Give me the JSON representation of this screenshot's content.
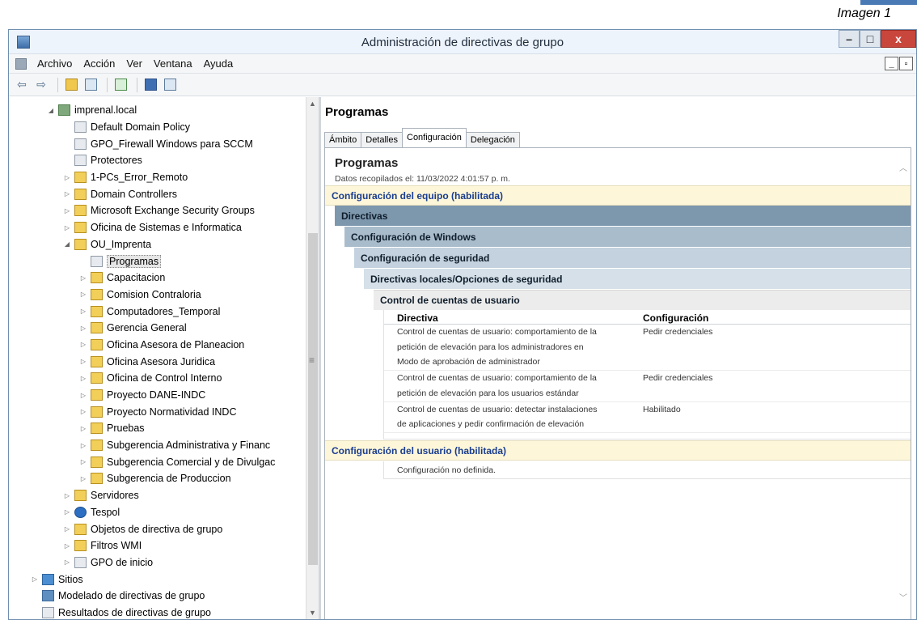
{
  "caption": "Imagen 1",
  "window": {
    "title": "Administración de directivas de grupo"
  },
  "menu": [
    "Archivo",
    "Acción",
    "Ver",
    "Ventana",
    "Ayuda"
  ],
  "tree": [
    {
      "label": "imprenal.local",
      "depth": 3,
      "expander": "open",
      "icon": "domain"
    },
    {
      "label": "Default Domain Policy",
      "depth": 4,
      "expander": "none",
      "icon": "gpo"
    },
    {
      "label": "GPO_Firewall Windows para SCCM",
      "depth": 4,
      "expander": "none",
      "icon": "gpo"
    },
    {
      "label": "Protectores",
      "depth": 4,
      "expander": "none",
      "icon": "gpo"
    },
    {
      "label": "1-PCs_Error_Remoto",
      "depth": 4,
      "expander": "closed",
      "icon": "ou"
    },
    {
      "label": "Domain Controllers",
      "depth": 4,
      "expander": "closed",
      "icon": "ou"
    },
    {
      "label": "Microsoft Exchange Security Groups",
      "depth": 4,
      "expander": "closed",
      "icon": "ou"
    },
    {
      "label": "Oficina de Sistemas e Informatica",
      "depth": 4,
      "expander": "closed",
      "icon": "ou"
    },
    {
      "label": "OU_Imprenta",
      "depth": 4,
      "expander": "open",
      "icon": "ou"
    },
    {
      "label": "Programas",
      "depth": 5,
      "expander": "none",
      "icon": "gpo",
      "selected": true
    },
    {
      "label": "Capacitacion",
      "depth": 5,
      "expander": "closed",
      "icon": "ou"
    },
    {
      "label": "Comision Contraloria",
      "depth": 5,
      "expander": "closed",
      "icon": "ou"
    },
    {
      "label": "Computadores_Temporal",
      "depth": 5,
      "expander": "closed",
      "icon": "ou"
    },
    {
      "label": "Gerencia General",
      "depth": 5,
      "expander": "closed",
      "icon": "ou"
    },
    {
      "label": "Oficina Asesora de Planeacion",
      "depth": 5,
      "expander": "closed",
      "icon": "ou"
    },
    {
      "label": "Oficina Asesora Juridica",
      "depth": 5,
      "expander": "closed",
      "icon": "ou"
    },
    {
      "label": "Oficina de Control Interno",
      "depth": 5,
      "expander": "closed",
      "icon": "ou"
    },
    {
      "label": "Proyecto DANE-INDC",
      "depth": 5,
      "expander": "closed",
      "icon": "ou"
    },
    {
      "label": "Proyecto Normatividad INDC",
      "depth": 5,
      "expander": "closed",
      "icon": "ou"
    },
    {
      "label": "Pruebas",
      "depth": 5,
      "expander": "closed",
      "icon": "ou"
    },
    {
      "label": "Subgerencia Administrativa y Financ",
      "depth": 5,
      "expander": "closed",
      "icon": "ou"
    },
    {
      "label": "Subgerencia Comercial y de Divulgac",
      "depth": 5,
      "expander": "closed",
      "icon": "ou"
    },
    {
      "label": "Subgerencia de Produccion",
      "depth": 5,
      "expander": "closed",
      "icon": "ou"
    },
    {
      "label": "Servidores",
      "depth": 4,
      "expander": "closed",
      "icon": "ou"
    },
    {
      "label": "Tespol",
      "depth": 4,
      "expander": "closed",
      "icon": "info"
    },
    {
      "label": "Objetos de directiva de grupo",
      "depth": 4,
      "expander": "closed",
      "icon": "ou"
    },
    {
      "label": "Filtros WMI",
      "depth": 4,
      "expander": "closed",
      "icon": "ou"
    },
    {
      "label": "GPO de inicio",
      "depth": 4,
      "expander": "closed",
      "icon": "gpo"
    },
    {
      "label": "Sitios",
      "depth": 2,
      "expander": "closed",
      "icon": "site"
    },
    {
      "label": "Modelado de directivas de grupo",
      "depth": 2,
      "expander": "none",
      "icon": "model"
    },
    {
      "label": "Resultados de directivas de grupo",
      "depth": 2,
      "expander": "none",
      "icon": "gpo"
    }
  ],
  "right": {
    "title": "Programas",
    "tabs": [
      "Ámbito",
      "Detalles",
      "Configuración",
      "Delegación"
    ],
    "active_tab": "Configuración",
    "report": {
      "title": "Programas",
      "meta": "Datos recopilados el: 11/03/2022 4:01:57 p. m.",
      "computer_config": "Configuración del equipo (habilitada)",
      "levels": [
        "Directivas",
        "Configuración de Windows",
        "Configuración de seguridad",
        "Directivas locales/Opciones de seguridad",
        "Control de cuentas de usuario"
      ],
      "table": {
        "headers": [
          "Directiva",
          "Configuración"
        ],
        "rows": [
          {
            "policy": [
              "Control de cuentas de usuario: comportamiento de la",
              "petición de elevación para los administradores en",
              "Modo de aprobación de administrador"
            ],
            "setting": "Pedir credenciales"
          },
          {
            "policy": [
              "Control de cuentas de usuario: comportamiento de la",
              "petición de elevación para los usuarios estándar"
            ],
            "setting": "Pedir credenciales"
          },
          {
            "policy": [
              "Control de cuentas de usuario: detectar instalaciones",
              "de aplicaciones y pedir confirmación de elevación"
            ],
            "setting": "Habilitado"
          }
        ]
      },
      "user_config": "Configuración del usuario (habilitada)",
      "user_note": "Configuración no definida."
    }
  }
}
